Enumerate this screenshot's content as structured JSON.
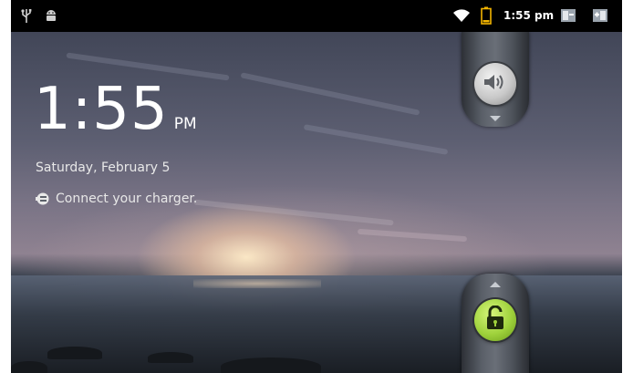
{
  "status_bar": {
    "time": "1:55 pm",
    "icons": [
      "usb-icon",
      "android-debug-icon",
      "wifi-icon",
      "battery-icon",
      "notification-icon",
      "notification-icon-2"
    ]
  },
  "lockscreen": {
    "time": "1:55",
    "ampm": "PM",
    "date": "Saturday, February 5",
    "charger_message": "Connect your charger.",
    "sound_tab_icon": "speaker-volume-icon",
    "unlock_tab_icon": "padlock-open-icon"
  },
  "colors": {
    "unlock_accent": "#9fd23c",
    "battery_outline": "#f2b400",
    "status_bar_bg": "#000000"
  }
}
